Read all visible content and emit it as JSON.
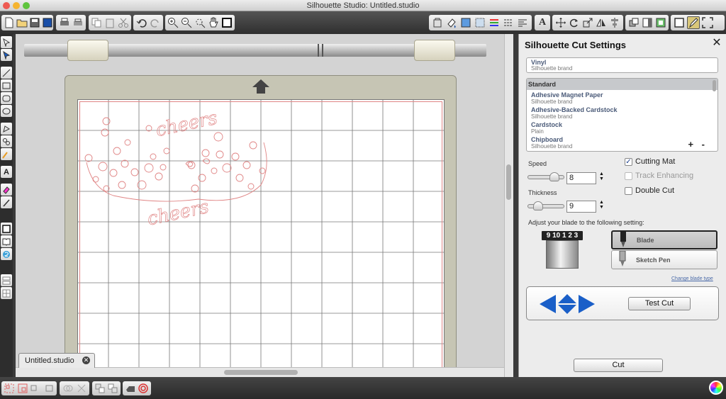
{
  "window": {
    "title": "Silhouette Studio: Untitled.studio"
  },
  "document_tab": {
    "label": "Untitled.studio"
  },
  "mat": {
    "sample_text_1": "cheers",
    "sample_text_2": "cheers",
    "line_color": "#e08585"
  },
  "panel": {
    "title": "Silhouette Cut Settings",
    "current_material": {
      "name": "Vinyl",
      "brand": "Silhouette brand"
    },
    "material_list": {
      "header": "Standard",
      "items": [
        {
          "name": "Adhesive Magnet Paper",
          "brand": "Silhouette brand"
        },
        {
          "name": "Adhesive-Backed Cardstock",
          "brand": "Silhouette brand"
        },
        {
          "name": "Cardstock",
          "brand": "Plain"
        },
        {
          "name": "Chipboard",
          "brand": "Silhouette brand"
        }
      ],
      "add_remove": "+ -"
    },
    "speed": {
      "label": "Speed",
      "value": "8",
      "fraction": 0.73
    },
    "thickness": {
      "label": "Thickness",
      "value": "9",
      "fraction": 0.27
    },
    "options": {
      "cutting_mat": {
        "label": "Cutting Mat",
        "checked": true
      },
      "track_enhancing": {
        "label": "Track Enhancing",
        "checked": false,
        "disabled": true
      },
      "double_cut": {
        "label": "Double Cut",
        "checked": false
      }
    },
    "blade_instruction": "Adjust your blade to the following setting:",
    "blade_dial": "9 10 1 2 3",
    "tools": {
      "blade": "Blade",
      "sketch_pen": "Sketch Pen",
      "selected": "blade"
    },
    "change_blade_link": "Change blade type",
    "test_cut": "Test Cut",
    "cut": "Cut"
  },
  "colors": {
    "accent": "#1a5fc8",
    "mat_red": "#e08585",
    "toolbar_dark": "#3a3a3a"
  }
}
